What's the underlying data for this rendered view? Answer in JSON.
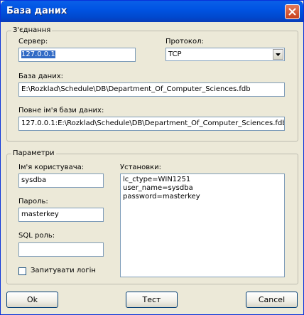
{
  "window": {
    "title": "База даних"
  },
  "connection": {
    "group_label": "З'єднання",
    "server_label": "Сервер:",
    "server_value": "127.0.0.1",
    "protocol_label": "Протокол:",
    "protocol_value": "TCP",
    "database_label": "База даних:",
    "database_value": "E:\\Rozklad\\Schedule\\DB\\Department_Of_Computer_Sciences.fdb",
    "full_name_label": "Повне ім'я бази даних:",
    "full_name_value": "127.0.0.1:E:\\Rozklad\\Schedule\\DB\\Department_Of_Computer_Sciences.fdb"
  },
  "params": {
    "group_label": "Параметри",
    "username_label": "Ім'я користувача:",
    "username_value": "sysdba",
    "password_label": "Пароль:",
    "password_value": "masterkey",
    "sql_role_label": "SQL роль:",
    "sql_role_value": "",
    "prompt_login_label": "Запитувати логін",
    "prompt_login_checked": false,
    "settings_label": "Установки:",
    "settings_lines": [
      "lc_ctype=WIN1251",
      "user_name=sysdba",
      "password=masterkey"
    ]
  },
  "buttons": {
    "ok": "Ok",
    "test": "Тест",
    "cancel": "Cancel"
  },
  "icons": {
    "close": "close-icon",
    "dropdown": "chevron-down-icon"
  },
  "colors": {
    "titlebar": "#0054e3",
    "selection": "#316ac5",
    "close": "#c8401c"
  }
}
